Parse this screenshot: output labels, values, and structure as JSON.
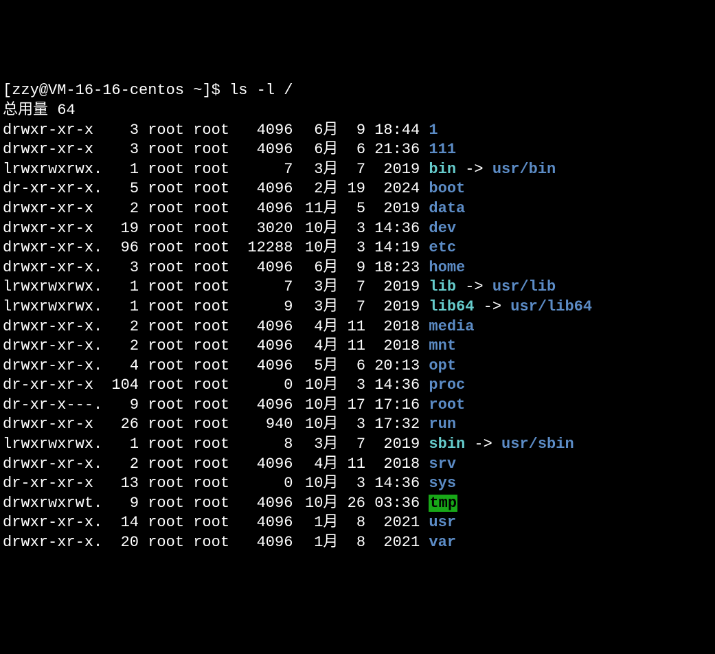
{
  "prompt": "[zzy@VM-16-16-centos ~]$ ",
  "command": "ls -l /",
  "total_label": "总用量 64",
  "entries": [
    {
      "perms": "drwxr-xr-x ",
      "links": "3",
      "owner": "root",
      "group": "root",
      "size": "4096",
      "month": "6月",
      "day": "9",
      "time": "18:44",
      "name": "1",
      "type": "dir"
    },
    {
      "perms": "drwxr-xr-x ",
      "links": "3",
      "owner": "root",
      "group": "root",
      "size": "4096",
      "month": "6月",
      "day": "6",
      "time": "21:36",
      "name": "111",
      "type": "dir"
    },
    {
      "perms": "lrwxrwxrwx.",
      "links": "1",
      "owner": "root",
      "group": "root",
      "size": "7",
      "month": "3月",
      "day": "7",
      "time": "2019",
      "name": "bin",
      "type": "lnk",
      "arrow": " -> ",
      "target": "usr/bin"
    },
    {
      "perms": "dr-xr-xr-x.",
      "links": "5",
      "owner": "root",
      "group": "root",
      "size": "4096",
      "month": "2月",
      "day": "19",
      "time": "2024",
      "name": "boot",
      "type": "dir"
    },
    {
      "perms": "drwxr-xr-x ",
      "links": "2",
      "owner": "root",
      "group": "root",
      "size": "4096",
      "month": "11月",
      "day": "5",
      "time": "2019",
      "name": "data",
      "type": "dir"
    },
    {
      "perms": "drwxr-xr-x ",
      "links": "19",
      "owner": "root",
      "group": "root",
      "size": "3020",
      "month": "10月",
      "day": "3",
      "time": "14:36",
      "name": "dev",
      "type": "dir"
    },
    {
      "perms": "drwxr-xr-x.",
      "links": "96",
      "owner": "root",
      "group": "root",
      "size": "12288",
      "month": "10月",
      "day": "3",
      "time": "14:19",
      "name": "etc",
      "type": "dir"
    },
    {
      "perms": "drwxr-xr-x.",
      "links": "3",
      "owner": "root",
      "group": "root",
      "size": "4096",
      "month": "6月",
      "day": "9",
      "time": "18:23",
      "name": "home",
      "type": "dir"
    },
    {
      "perms": "lrwxrwxrwx.",
      "links": "1",
      "owner": "root",
      "group": "root",
      "size": "7",
      "month": "3月",
      "day": "7",
      "time": "2019",
      "name": "lib",
      "type": "lnk",
      "arrow": " -> ",
      "target": "usr/lib"
    },
    {
      "perms": "lrwxrwxrwx.",
      "links": "1",
      "owner": "root",
      "group": "root",
      "size": "9",
      "month": "3月",
      "day": "7",
      "time": "2019",
      "name": "lib64",
      "type": "lnk",
      "arrow": " -> ",
      "target": "usr/lib64"
    },
    {
      "perms": "drwxr-xr-x.",
      "links": "2",
      "owner": "root",
      "group": "root",
      "size": "4096",
      "month": "4月",
      "day": "11",
      "time": "2018",
      "name": "media",
      "type": "dir"
    },
    {
      "perms": "drwxr-xr-x.",
      "links": "2",
      "owner": "root",
      "group": "root",
      "size": "4096",
      "month": "4月",
      "day": "11",
      "time": "2018",
      "name": "mnt",
      "type": "dir"
    },
    {
      "perms": "drwxr-xr-x.",
      "links": "4",
      "owner": "root",
      "group": "root",
      "size": "4096",
      "month": "5月",
      "day": "6",
      "time": "20:13",
      "name": "opt",
      "type": "dir"
    },
    {
      "perms": "dr-xr-xr-x ",
      "links": "104",
      "owner": "root",
      "group": "root",
      "size": "0",
      "month": "10月",
      "day": "3",
      "time": "14:36",
      "name": "proc",
      "type": "dir"
    },
    {
      "perms": "dr-xr-x---.",
      "links": "9",
      "owner": "root",
      "group": "root",
      "size": "4096",
      "month": "10月",
      "day": "17",
      "time": "17:16",
      "name": "root",
      "type": "dir"
    },
    {
      "perms": "drwxr-xr-x ",
      "links": "26",
      "owner": "root",
      "group": "root",
      "size": "940",
      "month": "10月",
      "day": "3",
      "time": "17:32",
      "name": "run",
      "type": "dir"
    },
    {
      "perms": "lrwxrwxrwx.",
      "links": "1",
      "owner": "root",
      "group": "root",
      "size": "8",
      "month": "3月",
      "day": "7",
      "time": "2019",
      "name": "sbin",
      "type": "lnk",
      "arrow": " -> ",
      "target": "usr/sbin"
    },
    {
      "perms": "drwxr-xr-x.",
      "links": "2",
      "owner": "root",
      "group": "root",
      "size": "4096",
      "month": "4月",
      "day": "11",
      "time": "2018",
      "name": "srv",
      "type": "dir"
    },
    {
      "perms": "dr-xr-xr-x ",
      "links": "13",
      "owner": "root",
      "group": "root",
      "size": "0",
      "month": "10月",
      "day": "3",
      "time": "14:36",
      "name": "sys",
      "type": "dir"
    },
    {
      "perms": "drwxrwxrwt.",
      "links": "9",
      "owner": "root",
      "group": "root",
      "size": "4096",
      "month": "10月",
      "day": "26",
      "time": "03:36",
      "name": "tmp",
      "type": "tmp"
    },
    {
      "perms": "drwxr-xr-x.",
      "links": "14",
      "owner": "root",
      "group": "root",
      "size": "4096",
      "month": "1月",
      "day": "8",
      "time": "2021",
      "name": "usr",
      "type": "dir"
    },
    {
      "perms": "drwxr-xr-x.",
      "links": "20",
      "owner": "root",
      "group": "root",
      "size": "4096",
      "month": "1月",
      "day": "8",
      "time": "2021",
      "name": "var",
      "type": "dir"
    }
  ]
}
